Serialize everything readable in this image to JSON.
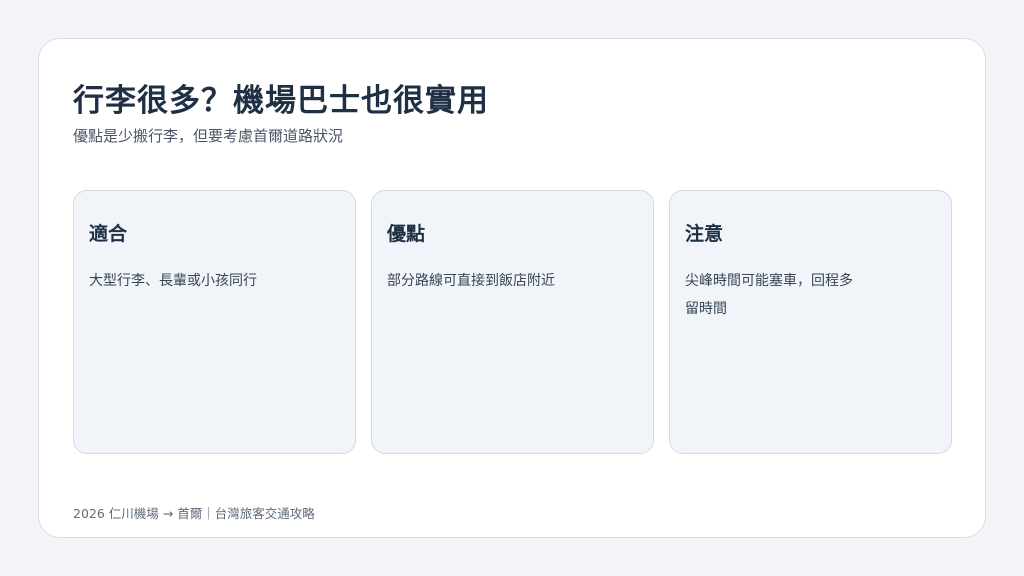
{
  "slide": {
    "title": "行李很多？機場巴士也很實用",
    "subtitle": "優點是少搬行李，但要考慮首爾道路狀況",
    "cards": [
      {
        "heading": "適合",
        "body": "大型行李、長輩或小孩同行"
      },
      {
        "heading": "優點",
        "body": "部分路線可直接到飯店附近"
      },
      {
        "heading": "注意",
        "body": "尖峰時間可能塞車，回程多留時間"
      }
    ],
    "footer": "2026 仁川機場 → 首爾｜台灣旅客交通攻略"
  },
  "colors": {
    "background": "#f3f5f8",
    "panel": "#ffffff",
    "card_fill": "#f1f5f9",
    "card_border": "#cfdae4",
    "title_text": "#1f2f44"
  }
}
